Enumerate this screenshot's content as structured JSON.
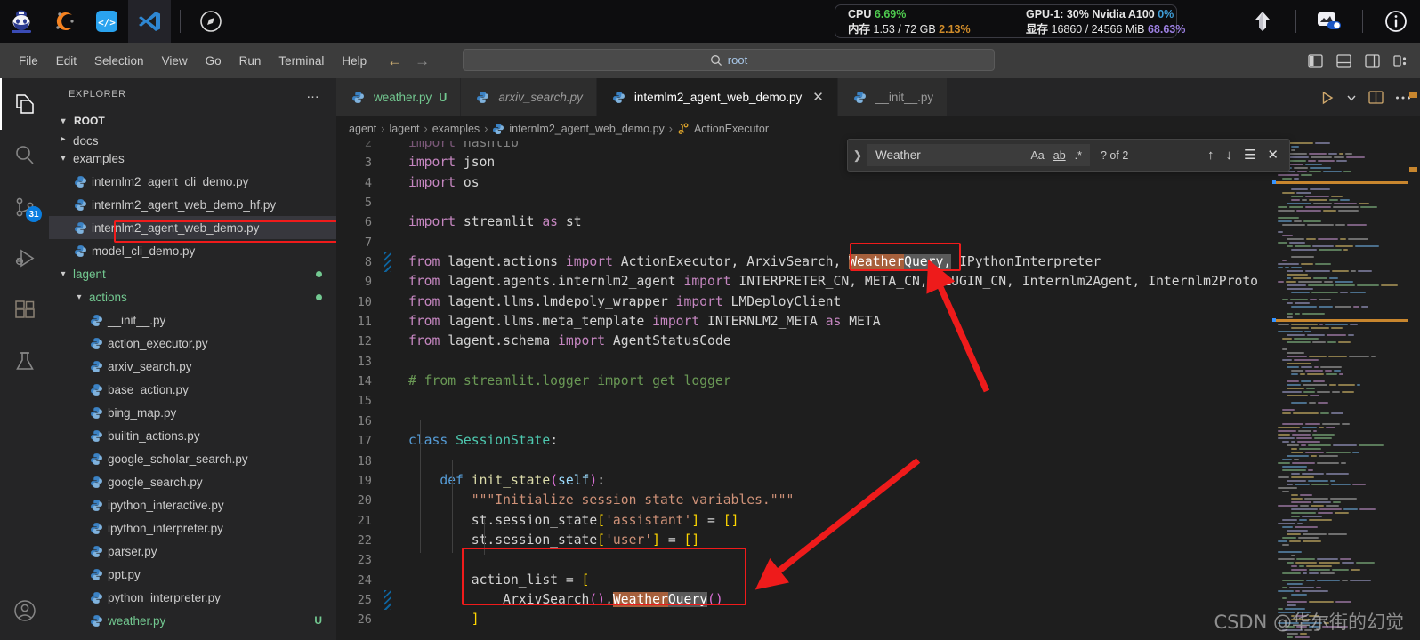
{
  "taskbar": {
    "icons": [
      {
        "name": "app-icon-mascot",
        "active": false
      },
      {
        "name": "app-icon-conda",
        "active": false
      },
      {
        "name": "app-icon-code-snippet",
        "active": false
      },
      {
        "name": "app-icon-vscode",
        "active": true
      },
      {
        "name": "app-icon-compass",
        "active": false
      }
    ],
    "right_icons": [
      {
        "name": "upload-arrow-icon"
      },
      {
        "name": "screen-share-toggle-icon"
      },
      {
        "name": "info-icon"
      }
    ]
  },
  "sysmon": {
    "cpu_label": "CPU",
    "cpu_value": "6.69%",
    "cpu_color": "#4ec94e",
    "gpu_label": "GPU-1: 30% Nvidia A100",
    "gpu_value": "0%",
    "gpu_color": "#3f9dd8",
    "mem_label": "内存",
    "mem_value": "1.53 / 72 GB",
    "mem_pct": "2.13%",
    "mem_color": "#d08c2a",
    "vram_label": "显存",
    "vram_value": "16860 / 24566 MiB",
    "vram_pct": "68.63%",
    "vram_color": "#9b7fe0"
  },
  "menubar": {
    "items": [
      "File",
      "Edit",
      "Selection",
      "View",
      "Go",
      "Run",
      "Terminal",
      "Help"
    ],
    "back_arrow": "←",
    "forward_arrow": "→"
  },
  "quickopen": {
    "icon": "search-icon",
    "value": "root"
  },
  "layout_buttons": [
    {
      "name": "toggle-primary-sidebar-icon"
    },
    {
      "name": "toggle-panel-icon"
    },
    {
      "name": "toggle-secondary-sidebar-icon"
    },
    {
      "name": "customize-layout-icon"
    }
  ],
  "activitybar": {
    "items": [
      {
        "name": "explorer-icon",
        "active": true,
        "badge": ""
      },
      {
        "name": "search-icon",
        "active": false,
        "badge": ""
      },
      {
        "name": "source-control-icon",
        "active": false,
        "badge": "31"
      },
      {
        "name": "run-and-debug-icon",
        "active": false,
        "badge": ""
      },
      {
        "name": "extensions-icon",
        "active": false,
        "badge": ""
      },
      {
        "name": "testing-flask-icon",
        "active": false,
        "badge": ""
      }
    ],
    "bottom": [
      {
        "name": "accounts-icon"
      }
    ]
  },
  "sidebar": {
    "title": "EXPLORER",
    "more_label": "…",
    "root_label": "ROOT",
    "tree": [
      {
        "label": "docs",
        "type": "folder",
        "expanded": false,
        "indent": 1,
        "clipped": true,
        "selected": false,
        "green": false,
        "dot": false,
        "suffix": ""
      },
      {
        "label": "examples",
        "type": "folder",
        "expanded": true,
        "indent": 1,
        "clipped": false,
        "selected": false,
        "green": false,
        "dot": false,
        "suffix": ""
      },
      {
        "label": "internlm2_agent_cli_demo.py",
        "type": "file",
        "indent": 2,
        "selected": false,
        "green": false,
        "dot": false,
        "suffix": ""
      },
      {
        "label": "internlm2_agent_web_demo_hf.py",
        "type": "file",
        "indent": 2,
        "selected": false,
        "green": false,
        "dot": false,
        "suffix": ""
      },
      {
        "label": "internlm2_agent_web_demo.py",
        "type": "file",
        "indent": 2,
        "selected": true,
        "green": false,
        "dot": false,
        "suffix": ""
      },
      {
        "label": "model_cli_demo.py",
        "type": "file",
        "indent": 2,
        "selected": false,
        "green": false,
        "dot": false,
        "suffix": ""
      },
      {
        "label": "lagent",
        "type": "folder",
        "expanded": true,
        "indent": 1,
        "selected": false,
        "green": true,
        "dot": true,
        "suffix": ""
      },
      {
        "label": "actions",
        "type": "folder",
        "expanded": true,
        "indent": 2,
        "selected": false,
        "green": true,
        "dot": true,
        "suffix": ""
      },
      {
        "label": "__init__.py",
        "type": "file",
        "indent": 3,
        "selected": false,
        "green": false,
        "dot": false,
        "suffix": ""
      },
      {
        "label": "action_executor.py",
        "type": "file",
        "indent": 3,
        "selected": false,
        "green": false,
        "dot": false,
        "suffix": ""
      },
      {
        "label": "arxiv_search.py",
        "type": "file",
        "indent": 3,
        "selected": false,
        "green": false,
        "dot": false,
        "suffix": ""
      },
      {
        "label": "base_action.py",
        "type": "file",
        "indent": 3,
        "selected": false,
        "green": false,
        "dot": false,
        "suffix": ""
      },
      {
        "label": "bing_map.py",
        "type": "file",
        "indent": 3,
        "selected": false,
        "green": false,
        "dot": false,
        "suffix": ""
      },
      {
        "label": "builtin_actions.py",
        "type": "file",
        "indent": 3,
        "selected": false,
        "green": false,
        "dot": false,
        "suffix": ""
      },
      {
        "label": "google_scholar_search.py",
        "type": "file",
        "indent": 3,
        "selected": false,
        "green": false,
        "dot": false,
        "suffix": ""
      },
      {
        "label": "google_search.py",
        "type": "file",
        "indent": 3,
        "selected": false,
        "green": false,
        "dot": false,
        "suffix": ""
      },
      {
        "label": "ipython_interactive.py",
        "type": "file",
        "indent": 3,
        "selected": false,
        "green": false,
        "dot": false,
        "suffix": ""
      },
      {
        "label": "ipython_interpreter.py",
        "type": "file",
        "indent": 3,
        "selected": false,
        "green": false,
        "dot": false,
        "suffix": ""
      },
      {
        "label": "parser.py",
        "type": "file",
        "indent": 3,
        "selected": false,
        "green": false,
        "dot": false,
        "suffix": ""
      },
      {
        "label": "ppt.py",
        "type": "file",
        "indent": 3,
        "selected": false,
        "green": false,
        "dot": false,
        "suffix": ""
      },
      {
        "label": "python_interpreter.py",
        "type": "file",
        "indent": 3,
        "selected": false,
        "green": false,
        "dot": false,
        "suffix": ""
      },
      {
        "label": "weather.py",
        "type": "file",
        "indent": 3,
        "selected": false,
        "green": true,
        "dot": false,
        "suffix": "U"
      }
    ]
  },
  "tabs": [
    {
      "label": "weather.py",
      "icon": "python-file-icon",
      "active": false,
      "italic": false,
      "green": true,
      "dirty": "U",
      "close": false
    },
    {
      "label": "arxiv_search.py",
      "icon": "python-file-icon",
      "active": false,
      "italic": true,
      "green": false,
      "dirty": "",
      "close": false
    },
    {
      "label": "internlm2_agent_web_demo.py",
      "icon": "python-file-icon",
      "active": true,
      "italic": false,
      "green": false,
      "dirty": "",
      "close": true
    },
    {
      "label": "__init__.py",
      "icon": "python-file-icon",
      "active": false,
      "italic": false,
      "green": false,
      "dirty": "",
      "close": false
    }
  ],
  "editor_actions": [
    {
      "name": "run-python-file-button",
      "glyph": "▷"
    },
    {
      "name": "run-options-chevron-icon",
      "glyph": "⌄"
    },
    {
      "name": "split-editor-right-button",
      "glyph": "split"
    },
    {
      "name": "more-actions-button",
      "glyph": "…"
    }
  ],
  "breadcrumb": {
    "parts": [
      "agent",
      "lagent",
      "examples",
      "internlm2_agent_web_demo.py",
      "ActionExecutor"
    ],
    "separator": "›",
    "file_icon": "python-file-icon",
    "symbol_icon": "class-symbol-icon"
  },
  "find_widget": {
    "expand_icon": "chevron-right-icon",
    "query": "Weather",
    "match_case_label": "Aa",
    "whole_word_label": "ab",
    "regex_label": ".*",
    "results": "? of 2",
    "prev_icon": "↑",
    "next_icon": "↓",
    "find_in_selection_icon": "☰",
    "close_icon": "✕"
  },
  "code": {
    "first_line": 2,
    "lines": [
      {
        "n": 2,
        "diff": false,
        "clipped": true,
        "tokens": [
          {
            "t": "import",
            "c": "t-kw"
          },
          {
            "t": " hashlib",
            "c": "t-plain"
          }
        ]
      },
      {
        "n": 3,
        "diff": false,
        "tokens": [
          {
            "t": "import",
            "c": "t-kw"
          },
          {
            "t": " json",
            "c": "t-plain"
          }
        ]
      },
      {
        "n": 4,
        "diff": false,
        "tokens": [
          {
            "t": "import",
            "c": "t-kw"
          },
          {
            "t": " os",
            "c": "t-plain"
          }
        ]
      },
      {
        "n": 5,
        "diff": false,
        "tokens": []
      },
      {
        "n": 6,
        "diff": false,
        "tokens": [
          {
            "t": "import",
            "c": "t-kw"
          },
          {
            "t": " streamlit ",
            "c": "t-plain"
          },
          {
            "t": "as",
            "c": "t-kw"
          },
          {
            "t": " st",
            "c": "t-plain"
          }
        ]
      },
      {
        "n": 7,
        "diff": false,
        "tokens": []
      },
      {
        "n": 8,
        "diff": true,
        "tokens": [
          {
            "t": "from",
            "c": "t-kw"
          },
          {
            "t": " lagent.actions ",
            "c": "t-plain"
          },
          {
            "t": "import",
            "c": "t-kw"
          },
          {
            "t": " ActionExecutor, ArxivSearch, ",
            "c": "t-plain"
          },
          {
            "t": "Weather",
            "c": "t-plain m-cur"
          },
          {
            "t": "Query,",
            "c": "t-plain m-sel"
          },
          {
            "t": " IPythonInterpreter",
            "c": "t-plain"
          }
        ]
      },
      {
        "n": 9,
        "diff": false,
        "tokens": [
          {
            "t": "from",
            "c": "t-kw"
          },
          {
            "t": " lagent.agents.internlm2_agent ",
            "c": "t-plain"
          },
          {
            "t": "import",
            "c": "t-kw"
          },
          {
            "t": " INTERPRETER_CN, META_CN, PLUGIN_CN, Internlm2Agent, Internlm2Proto",
            "c": "t-plain"
          }
        ]
      },
      {
        "n": 10,
        "diff": false,
        "tokens": [
          {
            "t": "from",
            "c": "t-kw"
          },
          {
            "t": " lagent.llms.lmdepoly_wrapper ",
            "c": "t-plain"
          },
          {
            "t": "import",
            "c": "t-kw"
          },
          {
            "t": " LMDeployClient",
            "c": "t-plain"
          }
        ]
      },
      {
        "n": 11,
        "diff": false,
        "tokens": [
          {
            "t": "from",
            "c": "t-kw"
          },
          {
            "t": " lagent.llms.meta_template ",
            "c": "t-plain"
          },
          {
            "t": "import",
            "c": "t-kw"
          },
          {
            "t": " INTERNLM2_META ",
            "c": "t-plain"
          },
          {
            "t": "as",
            "c": "t-kw"
          },
          {
            "t": " META",
            "c": "t-plain"
          }
        ]
      },
      {
        "n": 12,
        "diff": false,
        "tokens": [
          {
            "t": "from",
            "c": "t-kw"
          },
          {
            "t": " lagent.schema ",
            "c": "t-plain"
          },
          {
            "t": "import",
            "c": "t-kw"
          },
          {
            "t": " AgentStatusCode",
            "c": "t-plain"
          }
        ]
      },
      {
        "n": 13,
        "diff": false,
        "tokens": []
      },
      {
        "n": 14,
        "diff": false,
        "tokens": [
          {
            "t": "# from streamlit.logger import get_logger",
            "c": "t-cmt"
          }
        ]
      },
      {
        "n": 15,
        "diff": false,
        "tokens": []
      },
      {
        "n": 16,
        "diff": false,
        "tokens": []
      },
      {
        "n": 17,
        "diff": false,
        "tokens": [
          {
            "t": "class",
            "c": "t-kw2"
          },
          {
            "t": " ",
            "c": "t-plain"
          },
          {
            "t": "SessionState",
            "c": "t-cls"
          },
          {
            "t": ":",
            "c": "t-plain"
          }
        ]
      },
      {
        "n": 18,
        "diff": false,
        "tokens": []
      },
      {
        "n": 19,
        "diff": false,
        "tokens": [
          {
            "t": "    ",
            "c": "t-plain"
          },
          {
            "t": "def",
            "c": "t-kw2"
          },
          {
            "t": " ",
            "c": "t-plain"
          },
          {
            "t": "init_state",
            "c": "t-fn"
          },
          {
            "t": "(",
            "c": "t-brk2"
          },
          {
            "t": "self",
            "c": "t-var"
          },
          {
            "t": ")",
            "c": "t-brk2"
          },
          {
            "t": ":",
            "c": "t-plain"
          }
        ]
      },
      {
        "n": 20,
        "diff": false,
        "tokens": [
          {
            "t": "        ",
            "c": "t-plain"
          },
          {
            "t": "\"\"\"Initialize session state variables.\"\"\"",
            "c": "t-str"
          }
        ]
      },
      {
        "n": 21,
        "diff": false,
        "tokens": [
          {
            "t": "        st.session_state",
            "c": "t-plain"
          },
          {
            "t": "[",
            "c": "t-brk1"
          },
          {
            "t": "'assistant'",
            "c": "t-str"
          },
          {
            "t": "]",
            "c": "t-brk1"
          },
          {
            "t": " = ",
            "c": "t-plain"
          },
          {
            "t": "[]",
            "c": "t-brk1"
          }
        ]
      },
      {
        "n": 22,
        "diff": false,
        "tokens": [
          {
            "t": "        st.session_state",
            "c": "t-plain"
          },
          {
            "t": "[",
            "c": "t-brk1"
          },
          {
            "t": "'user'",
            "c": "t-str"
          },
          {
            "t": "]",
            "c": "t-brk1"
          },
          {
            "t": " = ",
            "c": "t-plain"
          },
          {
            "t": "[]",
            "c": "t-brk1"
          }
        ]
      },
      {
        "n": 23,
        "diff": false,
        "tokens": []
      },
      {
        "n": 24,
        "diff": false,
        "tokens": [
          {
            "t": "        action_list = ",
            "c": "t-plain"
          },
          {
            "t": "[",
            "c": "t-brk1"
          }
        ]
      },
      {
        "n": 25,
        "diff": true,
        "tokens": [
          {
            "t": "            ArxivSearch",
            "c": "t-plain"
          },
          {
            "t": "()",
            "c": "t-brk2"
          },
          {
            "t": ",",
            "c": "t-plain"
          },
          {
            "t": "Weather",
            "c": "t-plain m-cur"
          },
          {
            "t": "Query",
            "c": "t-plain m-sel"
          },
          {
            "t": "()",
            "c": "t-brk2"
          }
        ]
      },
      {
        "n": 26,
        "diff": false,
        "tokens": [
          {
            "t": "        ",
            "c": "t-plain"
          },
          {
            "t": "]",
            "c": "t-brk1"
          }
        ]
      }
    ]
  },
  "annotations": {
    "highlight_color": "#f01b1b",
    "arrow_color": "#ee1b1b",
    "boxes": [
      {
        "name": "highlight-box-sidebar-file",
        "target": "internlm2_agent_web_demo.py"
      },
      {
        "name": "highlight-box-weatherquery-import",
        "target": "WeatherQuery,"
      },
      {
        "name": "highlight-box-action-list",
        "target": "action_list = [ ArxivSearch(),WeatherQuery() ]"
      }
    ],
    "arrows": [
      {
        "name": "arrow-to-weatherquery-import"
      },
      {
        "name": "arrow-to-action-list"
      }
    ]
  },
  "watermark": {
    "text": "CSDN @华尔街的幻觉"
  }
}
